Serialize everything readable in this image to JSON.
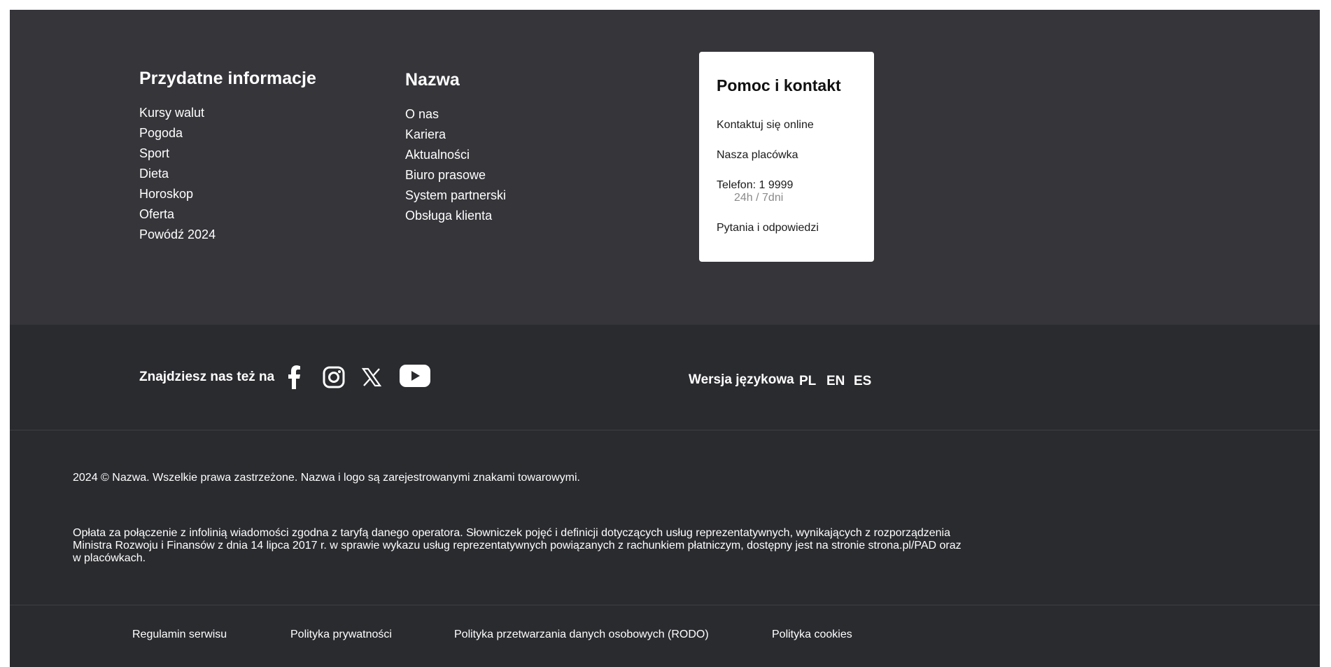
{
  "useful_info": {
    "heading": "Przydatne informacje",
    "items": [
      "Kursy walut",
      "Pogoda",
      "Sport",
      "Dieta",
      "Horoskop",
      "Oferta",
      "Powódź 2024"
    ]
  },
  "company": {
    "heading": "Nazwa",
    "items": [
      "O nas",
      "Kariera",
      "Aktualności",
      "Biuro prasowe",
      "System partnerski",
      "Obsługa klienta"
    ]
  },
  "contact": {
    "heading": "Pomoc i kontakt",
    "online": "Kontaktuj się online",
    "branch": "Nasza placówka",
    "phone": "Telefon: 1 9999",
    "phone_hours": "24h / 7dni",
    "faq": "Pytania i odpowiedzi"
  },
  "social": {
    "label": "Znajdziesz nas też na",
    "icons": [
      "facebook-icon",
      "instagram-icon",
      "x-icon",
      "youtube-icon"
    ]
  },
  "language": {
    "label": "Wersja językowa",
    "options": [
      "PL",
      "EN",
      "ES"
    ]
  },
  "legal": {
    "copyright": "2024 © Nazwa. Wszelkie prawa zastrzeżone. Nazwa i logo są zarejestrowanymi znakami towarowymi.",
    "disclaimer": "Opłata za połączenie z infolinią wiadomości zgodna z taryfą danego operatora. Słowniczek pojęć i definicji dotyczących usług reprezentatywnych, wynikających z rozporządzenia Ministra Rozwoju i Finansów z dnia 14 lipca 2017 r. w sprawie wykazu usług reprezentatywnych powiązanych z rachunkiem płatniczym, dostępny jest na stronie strona.pl/PAD oraz w placówkach."
  },
  "bottom_links": [
    "Regulamin serwisu",
    "Polityka prywatności",
    "Polityka przetwarzania danych osobowych (RODO)",
    "Polityka cookies"
  ],
  "colors": {
    "footer_bg": "#35353a",
    "band_bg": "#2a2b2f",
    "card_bg": "#ffffff",
    "text": "#ffffff",
    "muted": "#8a8a8a"
  }
}
